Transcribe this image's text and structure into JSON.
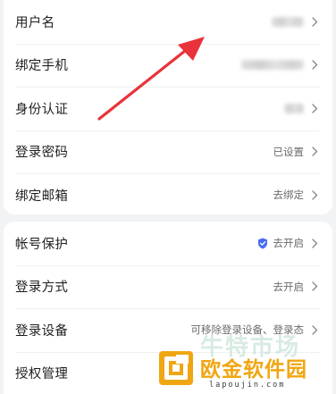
{
  "account_section": {
    "rows": [
      {
        "label": "用户名",
        "value": ""
      },
      {
        "label": "绑定手机",
        "value": ""
      },
      {
        "label": "身份认证",
        "value": ""
      },
      {
        "label": "登录密码",
        "value": "已设置"
      },
      {
        "label": "绑定邮箱",
        "value": "去绑定"
      }
    ]
  },
  "security_section": {
    "rows": [
      {
        "label": "帐号保护",
        "value": "去开启",
        "icon": "shield-icon",
        "icon_color": "#4a6cf7"
      },
      {
        "label": "登录方式",
        "value": "去开启"
      },
      {
        "label": "登录设备",
        "value": "可移除登录设备、登录态"
      },
      {
        "label": "授权管理",
        "value": ""
      }
    ]
  },
  "overlay": {
    "arrow_color": "#e8333a"
  },
  "watermark": {
    "ghost_text": "牛特市场",
    "brand_text": "欧金软件园",
    "url": "lapoujin.com",
    "brand_color": "#f0a612"
  }
}
